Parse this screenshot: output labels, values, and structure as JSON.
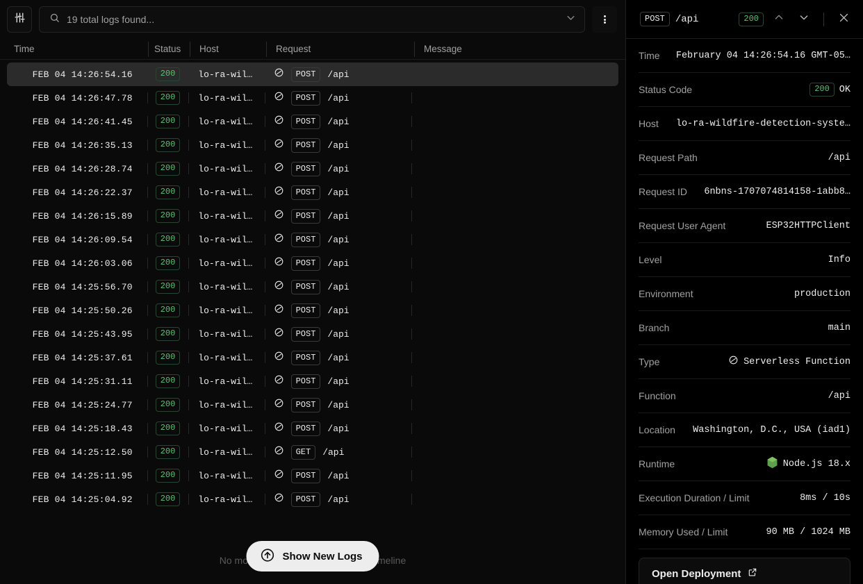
{
  "toolbar": {
    "filter_icon": "sliders-icon",
    "search_placeholder": "19 total logs found...",
    "search_value": "19 total logs found...",
    "chevron_icon": "chevron-down-icon",
    "menu_icon": "kebab-menu-icon"
  },
  "table": {
    "columns": [
      "Time",
      "Status",
      "Host",
      "Request",
      "Message"
    ],
    "rows": [
      {
        "time": "FEB 04 14:26:54.16",
        "status": "200",
        "host": "lo-ra-wil…",
        "type_icon": "serverless-function-icon",
        "method": "POST",
        "path": "/api",
        "message": "",
        "selected": true
      },
      {
        "time": "FEB 04 14:26:47.78",
        "status": "200",
        "host": "lo-ra-wil…",
        "type_icon": "serverless-function-icon",
        "method": "POST",
        "path": "/api",
        "message": "",
        "selected": false
      },
      {
        "time": "FEB 04 14:26:41.45",
        "status": "200",
        "host": "lo-ra-wil…",
        "type_icon": "serverless-function-icon",
        "method": "POST",
        "path": "/api",
        "message": "",
        "selected": false
      },
      {
        "time": "FEB 04 14:26:35.13",
        "status": "200",
        "host": "lo-ra-wil…",
        "type_icon": "serverless-function-icon",
        "method": "POST",
        "path": "/api",
        "message": "",
        "selected": false
      },
      {
        "time": "FEB 04 14:26:28.74",
        "status": "200",
        "host": "lo-ra-wil…",
        "type_icon": "serverless-function-icon",
        "method": "POST",
        "path": "/api",
        "message": "",
        "selected": false
      },
      {
        "time": "FEB 04 14:26:22.37",
        "status": "200",
        "host": "lo-ra-wil…",
        "type_icon": "serverless-function-icon",
        "method": "POST",
        "path": "/api",
        "message": "",
        "selected": false
      },
      {
        "time": "FEB 04 14:26:15.89",
        "status": "200",
        "host": "lo-ra-wil…",
        "type_icon": "serverless-function-icon",
        "method": "POST",
        "path": "/api",
        "message": "",
        "selected": false
      },
      {
        "time": "FEB 04 14:26:09.54",
        "status": "200",
        "host": "lo-ra-wil…",
        "type_icon": "serverless-function-icon",
        "method": "POST",
        "path": "/api",
        "message": "",
        "selected": false
      },
      {
        "time": "FEB 04 14:26:03.06",
        "status": "200",
        "host": "lo-ra-wil…",
        "type_icon": "serverless-function-icon",
        "method": "POST",
        "path": "/api",
        "message": "",
        "selected": false
      },
      {
        "time": "FEB 04 14:25:56.70",
        "status": "200",
        "host": "lo-ra-wil…",
        "type_icon": "serverless-function-icon",
        "method": "POST",
        "path": "/api",
        "message": "",
        "selected": false
      },
      {
        "time": "FEB 04 14:25:50.26",
        "status": "200",
        "host": "lo-ra-wil…",
        "type_icon": "serverless-function-icon",
        "method": "POST",
        "path": "/api",
        "message": "",
        "selected": false
      },
      {
        "time": "FEB 04 14:25:43.95",
        "status": "200",
        "host": "lo-ra-wil…",
        "type_icon": "serverless-function-icon",
        "method": "POST",
        "path": "/api",
        "message": "",
        "selected": false
      },
      {
        "time": "FEB 04 14:25:37.61",
        "status": "200",
        "host": "lo-ra-wil…",
        "type_icon": "serverless-function-icon",
        "method": "POST",
        "path": "/api",
        "message": "",
        "selected": false
      },
      {
        "time": "FEB 04 14:25:31.11",
        "status": "200",
        "host": "lo-ra-wil…",
        "type_icon": "serverless-function-icon",
        "method": "POST",
        "path": "/api",
        "message": "",
        "selected": false
      },
      {
        "time": "FEB 04 14:25:24.77",
        "status": "200",
        "host": "lo-ra-wil…",
        "type_icon": "serverless-function-icon",
        "method": "POST",
        "path": "/api",
        "message": "",
        "selected": false
      },
      {
        "time": "FEB 04 14:25:18.43",
        "status": "200",
        "host": "lo-ra-wil…",
        "type_icon": "serverless-function-icon",
        "method": "POST",
        "path": "/api",
        "message": "",
        "selected": false
      },
      {
        "time": "FEB 04 14:25:12.50",
        "status": "200",
        "host": "lo-ra-wil…",
        "type_icon": "serverless-function-icon",
        "method": "GET",
        "path": "/api",
        "message": "",
        "selected": false
      },
      {
        "time": "FEB 04 14:25:11.95",
        "status": "200",
        "host": "lo-ra-wil…",
        "type_icon": "serverless-function-icon",
        "method": "POST",
        "path": "/api",
        "message": "",
        "selected": false
      },
      {
        "time": "FEB 04 14:25:04.92",
        "status": "200",
        "host": "lo-ra-wil…",
        "type_icon": "serverless-function-icon",
        "method": "POST",
        "path": "/api",
        "message": "",
        "selected": false
      }
    ]
  },
  "footer": {
    "empty_note": "No more logs found in the selected timeline",
    "show_new_logs_label": "Show New Logs",
    "show_new_logs_icon": "arrow-up-circle-icon"
  },
  "detail": {
    "header": {
      "method": "POST",
      "path": "/api",
      "status": "200",
      "prev_icon": "chevron-up-icon",
      "next_icon": "chevron-down-icon",
      "close_icon": "close-icon"
    },
    "fields": [
      {
        "label": "Time",
        "value": "February 04 14:26:54.16 GMT-05…"
      },
      {
        "label": "Status Code",
        "value": "200",
        "suffix": "OK",
        "kind": "status"
      },
      {
        "label": "Host",
        "value": "lo-ra-wildfire-detection-syste…"
      },
      {
        "label": "Request Path",
        "value": "/api"
      },
      {
        "label": "Request ID",
        "value": "6nbns-1707074814158-1abb8…"
      },
      {
        "label": "Request User Agent",
        "value": "ESP32HTTPClient"
      },
      {
        "label": "Level",
        "value": "Info"
      },
      {
        "label": "Environment",
        "value": "production"
      },
      {
        "label": "Branch",
        "value": "main"
      },
      {
        "label": "Type",
        "value": "Serverless Function",
        "kind": "serverless"
      },
      {
        "label": "Function",
        "value": "/api"
      },
      {
        "label": "Location",
        "value": "Washington, D.C., USA (iad1)"
      },
      {
        "label": "Runtime",
        "value": "Node.js 18.x",
        "kind": "node"
      },
      {
        "label": "Execution Duration / Limit",
        "value": "8ms / 10s"
      },
      {
        "label": "Memory Used / Limit",
        "value": "90 MB / 1024 MB"
      }
    ],
    "open_deployment_label": "Open Deployment",
    "open_deployment_icon": "external-link-icon"
  },
  "colors": {
    "background": "#0a0a0a",
    "panel_background": "#000000",
    "status_green": "#62c073",
    "status_green_border": "#29462f",
    "text_primary": "#ededed",
    "text_muted": "#a1a1a1",
    "selected_row": "#2b2b2b",
    "node_green": "#5fa04e"
  }
}
